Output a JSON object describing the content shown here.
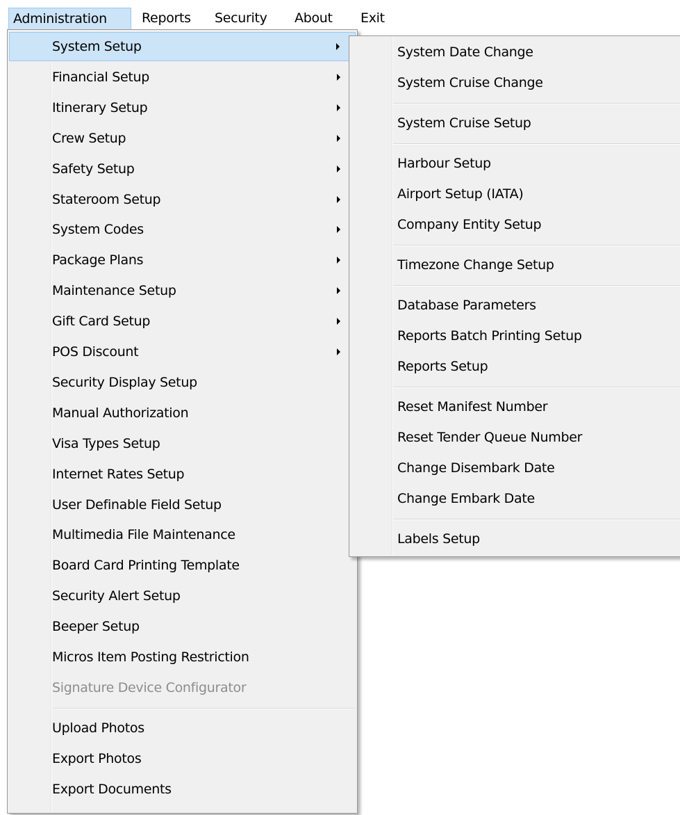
{
  "menubar": {
    "items": [
      "Administration",
      "Reports",
      "Security",
      "About",
      "Exit"
    ],
    "active_index": 0
  },
  "admin_menu": {
    "items": [
      {
        "label": "System Setup",
        "submenu": true,
        "highlighted": true
      },
      {
        "label": "Financial Setup",
        "submenu": true
      },
      {
        "label": "Itinerary Setup",
        "submenu": true
      },
      {
        "label": "Crew Setup",
        "submenu": true
      },
      {
        "label": "Safety Setup",
        "submenu": true
      },
      {
        "label": "Stateroom Setup",
        "submenu": true
      },
      {
        "label": "System Codes",
        "submenu": true
      },
      {
        "label": "Package Plans",
        "submenu": true
      },
      {
        "label": "Maintenance Setup",
        "submenu": true
      },
      {
        "label": "Gift Card Setup",
        "submenu": true
      },
      {
        "label": "POS Discount",
        "submenu": true
      },
      {
        "label": "Security Display Setup"
      },
      {
        "label": "Manual Authorization"
      },
      {
        "label": "Visa Types Setup"
      },
      {
        "label": "Internet Rates Setup"
      },
      {
        "label": "User Definable Field Setup"
      },
      {
        "label": "Multimedia File Maintenance"
      },
      {
        "label": "Board Card Printing Template"
      },
      {
        "label": "Security Alert Setup"
      },
      {
        "label": "Beeper Setup"
      },
      {
        "label": "Micros Item Posting Restriction"
      },
      {
        "label": "Signature Device Configurator",
        "disabled": true
      },
      {
        "separator": true
      },
      {
        "label": "Upload Photos"
      },
      {
        "label": "Export Photos"
      },
      {
        "label": "Export Documents"
      }
    ]
  },
  "system_setup_submenu": {
    "items": [
      {
        "label": "System Date Change"
      },
      {
        "label": "System Cruise Change"
      },
      {
        "separator": true
      },
      {
        "label": "System Cruise Setup"
      },
      {
        "separator": true
      },
      {
        "label": "Harbour Setup"
      },
      {
        "label": "Airport Setup (IATA)"
      },
      {
        "label": "Company Entity Setup"
      },
      {
        "separator": true
      },
      {
        "label": "Timezone Change Setup"
      },
      {
        "separator": true
      },
      {
        "label": "Database Parameters"
      },
      {
        "label": "Reports Batch Printing Setup"
      },
      {
        "label": "Reports Setup"
      },
      {
        "separator": true
      },
      {
        "label": "Reset Manifest Number"
      },
      {
        "label": "Reset Tender Queue Number"
      },
      {
        "label": "Change Disembark Date"
      },
      {
        "label": "Change Embark Date"
      },
      {
        "separator": true
      },
      {
        "label": "Labels Setup"
      }
    ]
  },
  "colors": {
    "highlight": "#cce4f7",
    "highlight_border": "#99c9ef",
    "menu_background": "#f0f0f0",
    "disabled_text": "#8d8d8d"
  }
}
